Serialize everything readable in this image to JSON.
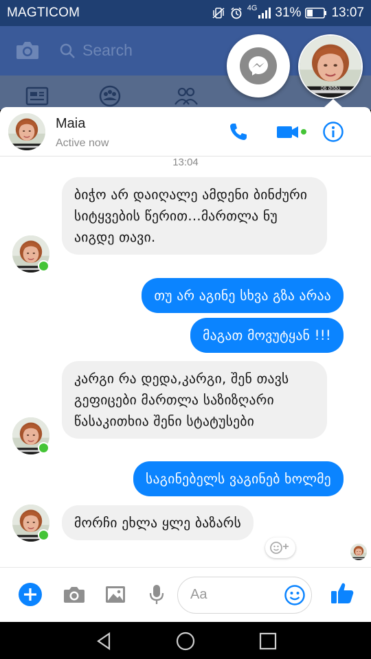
{
  "status_bar": {
    "carrier": "MAGTICOM",
    "network": "4G",
    "battery": "31%",
    "time": "13:07"
  },
  "facebook": {
    "search_placeholder": "Search"
  },
  "chat_head": {
    "badge_text": "ᲔᲜ ᲛᲘᲨᲐ"
  },
  "chat": {
    "contact_name": "Maia",
    "contact_status": "Active now",
    "timestamp": "13:04",
    "messages": [
      {
        "from": "them",
        "text": "ბიჭო არ დაიღალე ამდენი ბინძური სიტყვების წერით...მართლა ნუ აიგდე თავი."
      },
      {
        "from": "me",
        "text": "თუ არ აგინე სხვა გზა არაა"
      },
      {
        "from": "me",
        "text": "მაგათ მოვუტყან !!!"
      },
      {
        "from": "them",
        "text": "კარგი რა დედა,კარგი, შენ თავს გეფიცები მართლა საზიზღარი წასაკითხია შენი სტატუსები"
      },
      {
        "from": "me",
        "text": "საგინებელს ვაგინებ ხოლმე"
      },
      {
        "from": "them",
        "text": "მორჩი ეხლა ყლე ბაზარს"
      }
    ]
  },
  "composer": {
    "placeholder": "Aa"
  },
  "colors": {
    "messenger_blue": "#0b84ff",
    "incoming_bubble": "#f0f0f0",
    "facebook_header": "#3a5a99",
    "active_green": "#44c436"
  }
}
